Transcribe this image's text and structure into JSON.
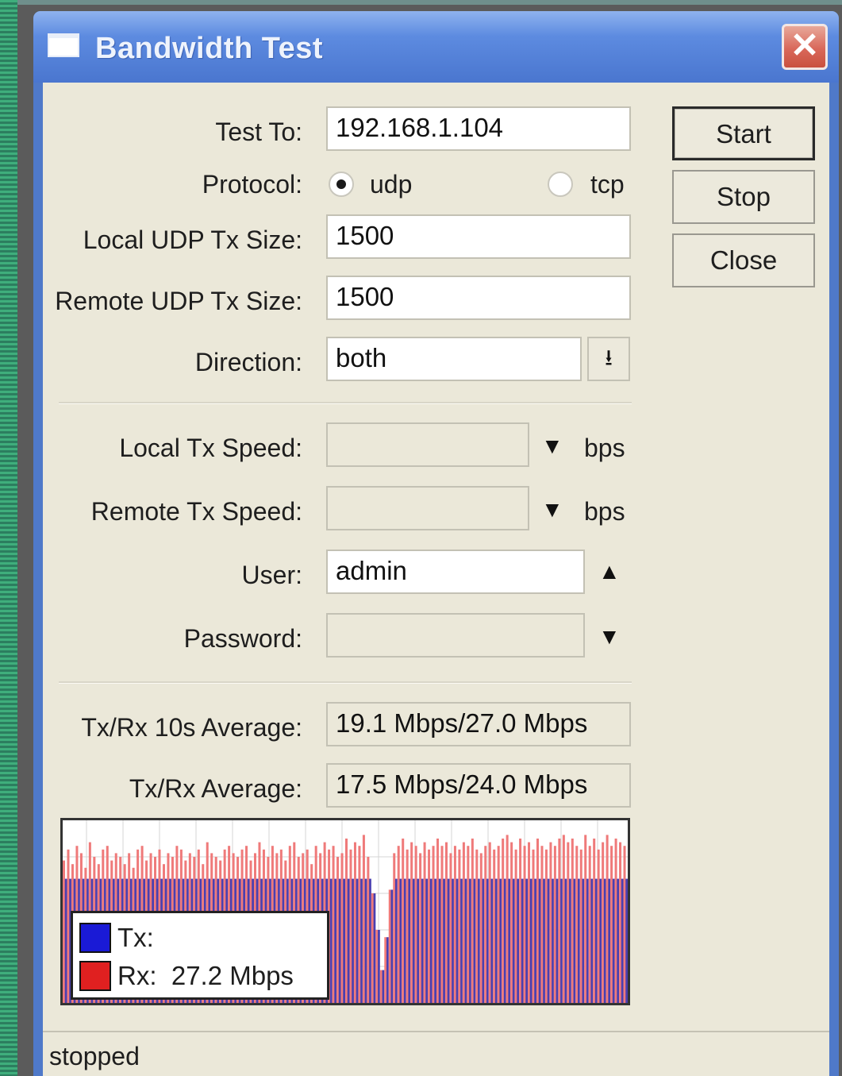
{
  "window": {
    "title": "Bandwidth Test",
    "close_label": "✕"
  },
  "form": {
    "test_to": {
      "label": "Test To:",
      "value": "192.168.1.104"
    },
    "protocol": {
      "label": "Protocol:",
      "options": [
        {
          "label": "udp",
          "selected": true
        },
        {
          "label": "tcp",
          "selected": false
        }
      ]
    },
    "local_udp_tx_size": {
      "label": "Local UDP Tx Size:",
      "value": "1500"
    },
    "remote_udp_tx_size": {
      "label": "Remote UDP Tx Size:",
      "value": "1500"
    },
    "direction": {
      "label": "Direction:",
      "value": "both",
      "dropdown_icon": "dropdown-arrow-icon"
    },
    "local_tx_speed": {
      "label": "Local Tx Speed:",
      "value": "",
      "unit": "bps"
    },
    "remote_tx_speed": {
      "label": "Remote Tx Speed:",
      "value": "",
      "unit": "bps"
    },
    "user": {
      "label": "User:",
      "value": "admin"
    },
    "password": {
      "label": "Password:",
      "value": ""
    },
    "txrx_10s_average": {
      "label": "Tx/Rx 10s Average:",
      "value": "19.1 Mbps/27.0 Mbps"
    },
    "txrx_average": {
      "label": "Tx/Rx Average:",
      "value": "17.5 Mbps/24.0 Mbps"
    }
  },
  "buttons": {
    "start": "Start",
    "stop": "Stop",
    "close": "Close"
  },
  "graph": {
    "colors": {
      "tx": "#1a1ad6",
      "rx": "#e02020",
      "rx_bar": "#ef7a7a"
    },
    "legend": {
      "tx_label": "Tx:",
      "rx_label": "Rx:",
      "rx_value": "27.2 Mbps"
    },
    "chart_data": {
      "type": "bar",
      "series": [
        {
          "name": "Tx",
          "values": [
            0.68,
            0.68,
            0.68,
            0.68,
            0.68,
            0.68,
            0.68,
            0.68,
            0.68,
            0.68,
            0.68,
            0.68,
            0.68,
            0.68,
            0.68,
            0.68,
            0.68,
            0.68,
            0.68,
            0.68,
            0.68,
            0.68,
            0.68,
            0.68,
            0.68,
            0.68,
            0.68,
            0.68,
            0.68,
            0.68,
            0.68,
            0.68,
            0.68,
            0.68,
            0.68,
            0.68,
            0.68,
            0.68,
            0.68,
            0.68,
            0.68,
            0.68,
            0.68,
            0.68,
            0.68,
            0.68,
            0.68,
            0.68,
            0.68,
            0.68,
            0.68,
            0.68,
            0.68,
            0.68,
            0.68,
            0.68,
            0.68,
            0.68,
            0.68,
            0.68,
            0.68,
            0.68,
            0.68,
            0.68,
            0.68,
            0.68,
            0.68,
            0.68,
            0.68,
            0.68,
            0.68,
            0.68,
            0.68,
            0.68,
            0.68,
            0.68,
            0.68,
            0.68,
            0.68,
            0.68,
            0.68,
            0.68,
            0.68,
            0.68,
            0.68,
            0.68,
            0.68,
            0.68,
            0.68,
            0.68,
            0.68,
            0.68,
            0.68,
            0.68,
            0.68,
            0.68,
            0.68,
            0.68,
            0.68,
            0.68,
            0.68,
            0.68,
            0.68,
            0.68,
            0.68,
            0.68,
            0.68,
            0.68,
            0.68,
            0.68,
            0.68,
            0.68,
            0.68,
            0.68,
            0.68,
            0.68,
            0.68,
            0.68,
            0.68,
            0.68,
            0.68,
            0.68,
            0.68,
            0.68,
            0.68,
            0.68,
            0.68,
            0.68,
            0.68,
            0.68,
            0.68,
            0.68,
            0.68,
            0.68,
            0.68,
            0.68,
            0.68,
            0.68,
            0.68,
            0.68,
            0.68,
            0.68,
            0.68,
            0.68,
            0.68,
            0.68,
            0.68,
            0.68,
            0.68,
            0.68,
            0.68,
            0.68,
            0.68,
            0.68,
            0.68,
            0.68,
            0.68,
            0.68,
            0.68,
            0.68,
            0.68,
            0.68,
            0.68,
            0.68,
            0.68,
            0.68,
            0.68,
            0.68,
            0.68,
            0.68,
            0.68,
            0.68,
            0.68,
            0.68,
            0.68,
            0.68,
            0.68,
            0.68,
            0.68,
            0.68,
            0.68,
            0.68,
            0.68,
            0.68,
            0.68,
            0.68,
            0.68,
            0.68,
            0.68,
            0.68,
            0.68,
            0.68,
            0.68,
            0.68,
            0.68,
            0.68,
            0.68,
            0.68,
            0.68,
            0.68,
            0.68,
            0.68,
            0.68,
            0.68,
            0.68,
            0.68,
            0.68,
            0.68,
            0.68,
            0.68,
            0.68,
            0.68,
            0.68,
            0.68,
            0.68,
            0.68,
            0.68,
            0.68,
            0.68,
            0.68,
            0.68,
            0.68,
            0.68,
            0.68,
            0.68,
            0.68,
            0.68,
            0.68,
            0.68,
            0.68,
            0.68,
            0.68,
            0.68,
            0.68,
            0.68,
            0.68,
            0.68,
            0.68,
            0.68,
            0.68,
            0.68,
            0.68,
            0.68,
            0.68,
            0.68,
            0.68,
            0.68,
            0.68,
            0.68,
            0.68,
            0.68,
            0.68,
            0.68,
            0.68,
            0.68,
            0.68,
            0.68,
            0.68,
            0.68,
            0.68,
            0.68,
            0.68,
            0.68,
            0.68,
            0.68,
            0.68,
            0.68,
            0.68,
            0.68,
            0.68,
            0.68,
            0.68,
            0.68,
            0.68,
            0.68,
            0.68,
            0.68,
            0.68,
            0.68,
            0.68,
            0.68,
            0.68,
            0.68,
            0.68,
            0.68,
            0.68,
            0.68,
            0.68,
            0.68,
            0.68,
            0.68,
            0.68
          ]
        },
        {
          "name": "Rx",
          "values": [
            0.78,
            0.84,
            0.76,
            0.86,
            0.82,
            0.74,
            0.88,
            0.8,
            0.76,
            0.84,
            0.86,
            0.78,
            0.82,
            0.8,
            0.76,
            0.82,
            0.74,
            0.84,
            0.86,
            0.78,
            0.82,
            0.8,
            0.84,
            0.76,
            0.82,
            0.8,
            0.86,
            0.84,
            0.78,
            0.82,
            0.8,
            0.84,
            0.76,
            0.88,
            0.82,
            0.8,
            0.78,
            0.84,
            0.86,
            0.82,
            0.8,
            0.84,
            0.86,
            0.78,
            0.82,
            0.88,
            0.84,
            0.8,
            0.86,
            0.82,
            0.84,
            0.78,
            0.86,
            0.88,
            0.8,
            0.82,
            0.84,
            0.76,
            0.86,
            0.82,
            0.88,
            0.84,
            0.86,
            0.8,
            0.82,
            0.9,
            0.84,
            0.88,
            0.86,
            0.92,
            0.8,
            0.6,
            0.4,
            0.18,
            0.36,
            0.62,
            0.82,
            0.86,
            0.9,
            0.84,
            0.88,
            0.86,
            0.82,
            0.88,
            0.84,
            0.86,
            0.9,
            0.86,
            0.88,
            0.82,
            0.86,
            0.84,
            0.88,
            0.86,
            0.9,
            0.84,
            0.82,
            0.86,
            0.88,
            0.84,
            0.86,
            0.9,
            0.92,
            0.88,
            0.84,
            0.9,
            0.86,
            0.88,
            0.84,
            0.9,
            0.86,
            0.84,
            0.88,
            0.86,
            0.9,
            0.92,
            0.88,
            0.9,
            0.86,
            0.84,
            0.92,
            0.86,
            0.9,
            0.84,
            0.88,
            0.92,
            0.86,
            0.9,
            0.88,
            0.86
          ]
        }
      ]
    }
  },
  "status": {
    "text": "stopped"
  }
}
